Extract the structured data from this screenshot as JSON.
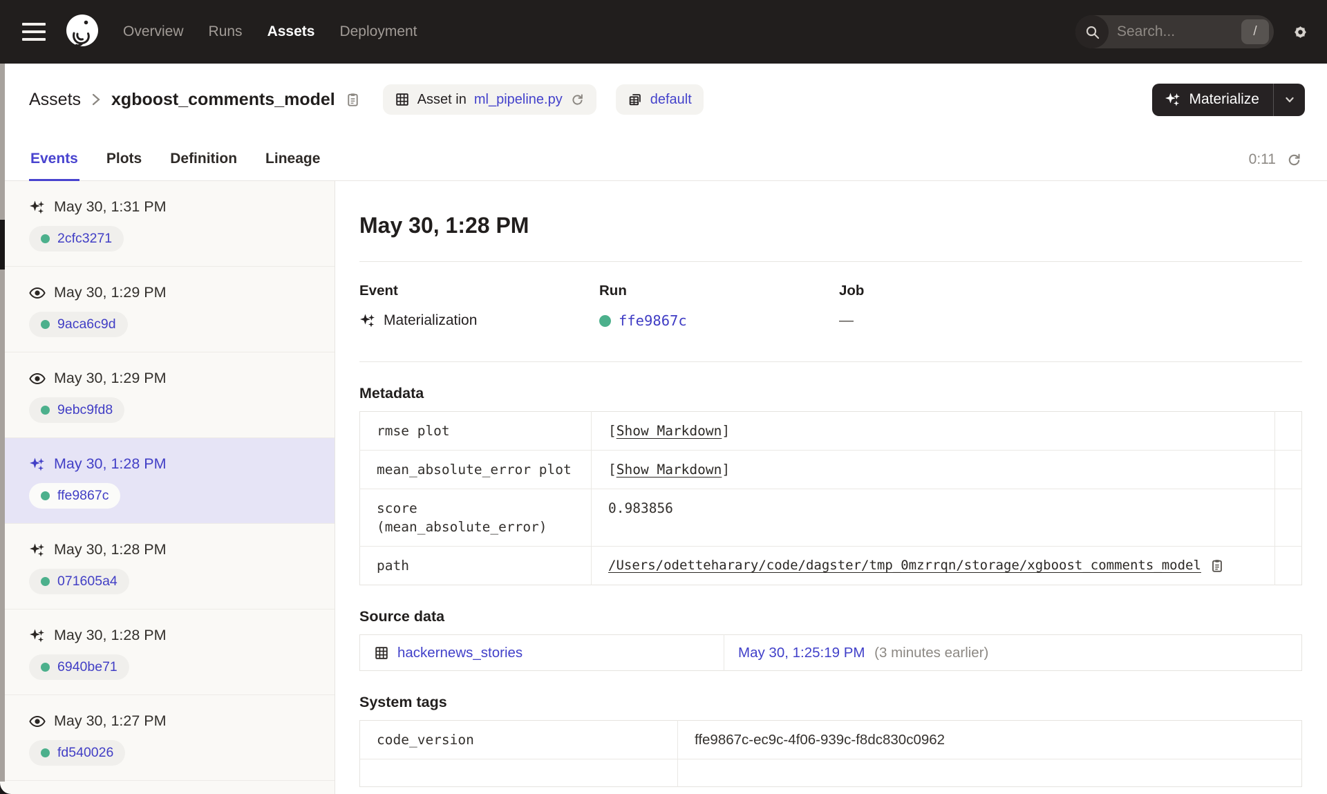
{
  "colors": {
    "topnav_bg": "#211e1d",
    "accent_purple": "#4843cf",
    "link_purple": "#413ec5",
    "success_green": "#4cb08c",
    "selected_row_bg": "#e6e4f6"
  },
  "topnav": {
    "nav_items": [
      {
        "label": "Overview"
      },
      {
        "label": "Runs"
      },
      {
        "label": "Assets"
      },
      {
        "label": "Deployment"
      }
    ],
    "search": {
      "placeholder": "Search...",
      "shortcut": "/"
    }
  },
  "breadcrumb": {
    "root": "Assets",
    "title": "xgboost_comments_model"
  },
  "definition_badge": {
    "prefix": "Asset in",
    "link": "ml_pipeline.py"
  },
  "group_badge": {
    "label": "default"
  },
  "materialize_button": {
    "label": "Materialize"
  },
  "tabs": {
    "items": [
      {
        "label": "Events"
      },
      {
        "label": "Plots"
      },
      {
        "label": "Definition"
      },
      {
        "label": "Lineage"
      }
    ],
    "timer": "0:11"
  },
  "sidebar": {
    "events": [
      {
        "type": "materialization",
        "time": "May 30, 1:31 PM",
        "run_id": "2cfc3271",
        "selected": false
      },
      {
        "type": "observation",
        "time": "May 30, 1:29 PM",
        "run_id": "9aca6c9d",
        "selected": false
      },
      {
        "type": "observation",
        "time": "May 30, 1:29 PM",
        "run_id": "9ebc9fd8",
        "selected": false
      },
      {
        "type": "materialization",
        "time": "May 30, 1:28 PM",
        "run_id": "ffe9867c",
        "selected": true
      },
      {
        "type": "materialization",
        "time": "May 30, 1:28 PM",
        "run_id": "071605a4",
        "selected": false
      },
      {
        "type": "materialization",
        "time": "May 30, 1:28 PM",
        "run_id": "6940be71",
        "selected": false
      },
      {
        "type": "observation",
        "time": "May 30, 1:27 PM",
        "run_id": "fd540026",
        "selected": false
      }
    ]
  },
  "main": {
    "heading": "May 30, 1:28 PM",
    "event": {
      "label": "Event",
      "value": "Materialization"
    },
    "run": {
      "label": "Run",
      "value": "ffe9867c"
    },
    "job": {
      "label": "Job",
      "value": "—"
    },
    "metadata": {
      "heading": "Metadata",
      "rows": [
        {
          "key": "rmse plot",
          "open": "[",
          "link": "Show Markdown",
          "close": "]"
        },
        {
          "key": "mean_absolute_error plot",
          "open": "[",
          "link": "Show Markdown",
          "close": "]"
        },
        {
          "key": "score (mean_absolute_error)",
          "value": "0.983856"
        },
        {
          "key": "path",
          "value": "/Users/odetteharary/code/dagster/tmp_0mzrrqn/storage/xgboost_comments_model"
        }
      ]
    },
    "source_data": {
      "heading": "Source data",
      "asset": "hackernews_stories",
      "timestamp": "May 30, 1:25:19 PM",
      "relative": "(3 minutes earlier)"
    },
    "system_tags": {
      "heading": "System tags",
      "rows": [
        {
          "key": "code_version",
          "value": "ffe9867c-ec9c-4f06-939c-f8dc830c0962"
        }
      ]
    }
  }
}
